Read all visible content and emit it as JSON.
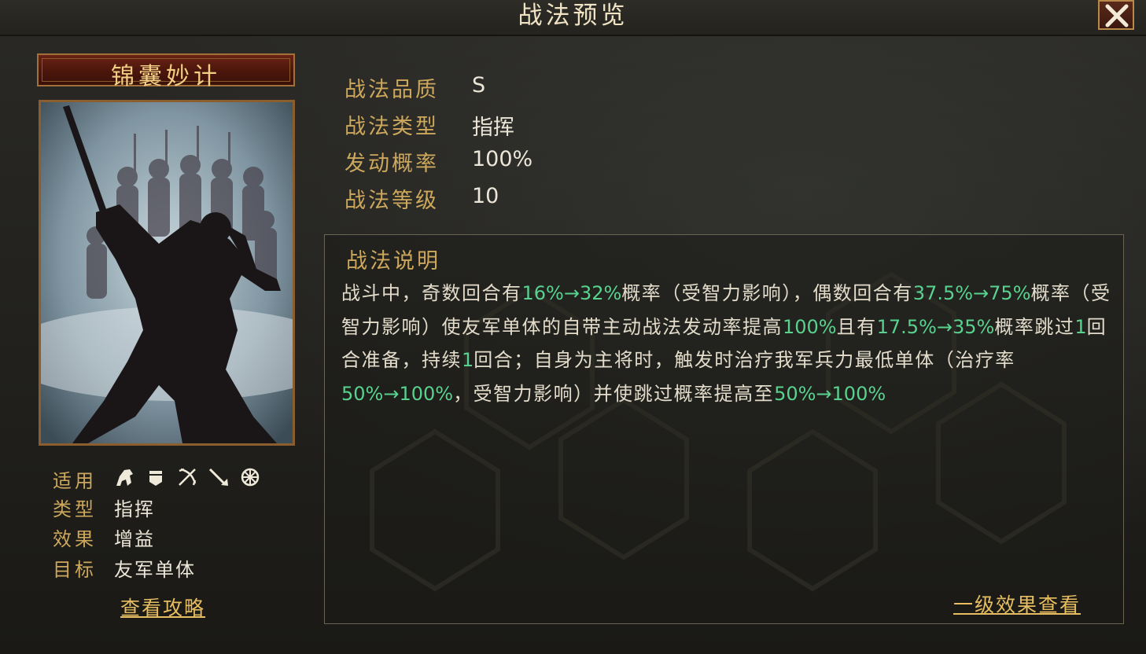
{
  "header": {
    "title": "战法预览",
    "close_icon": "close-icon"
  },
  "skill": {
    "name": "锦囊妙计",
    "card_icon": "warrior-silhouette-art",
    "applicable_label": "适用",
    "applicable_icons": [
      "cavalry-icon",
      "shield-icon",
      "archer-icon",
      "spear-icon",
      "siege-icon"
    ],
    "type_label": "类型",
    "type_value": "指挥",
    "effect_label": "效果",
    "effect_value": "增益",
    "target_label": "目标",
    "target_value": "友军单体",
    "guide_link": "查看攻略"
  },
  "info": {
    "quality_label": "战法品质",
    "quality_value": "S",
    "kind_label": "战法类型",
    "kind_value": "指挥",
    "rate_label": "发动概率",
    "rate_value": "100%",
    "level_label": "战法等级",
    "level_value": "10"
  },
  "description": {
    "title": "战法说明",
    "segments": [
      {
        "t": "战斗中，奇数回合有",
        "h": false
      },
      {
        "t": "16%→32%",
        "h": true
      },
      {
        "t": "概率（受智力影响），偶数回合有",
        "h": false
      },
      {
        "t": "37.5%→75%",
        "h": true
      },
      {
        "t": "概率（受智力影响）使友军单体的自带主动战法发动率提高",
        "h": false
      },
      {
        "t": "100%",
        "h": true
      },
      {
        "t": "且有",
        "h": false
      },
      {
        "t": "17.5%→35%",
        "h": true
      },
      {
        "t": "概率跳过",
        "h": false
      },
      {
        "t": "1",
        "h": true
      },
      {
        "t": "回合准备，持续",
        "h": false
      },
      {
        "t": "1",
        "h": true
      },
      {
        "t": "回合；自身为主将时，触发时治疗我军兵力最低单体（治疗率",
        "h": false
      },
      {
        "t": "50%→100%",
        "h": true
      },
      {
        "t": "，受智力影响）并使跳过概率提高至",
        "h": false
      },
      {
        "t": "50%→100%",
        "h": true
      }
    ],
    "level1_link": "一级效果查看"
  },
  "colors": {
    "label_gold": "#cda85c",
    "highlight_green": "#58d28e",
    "link_gold": "#e7bd62",
    "plate_red": "#6a2214"
  }
}
